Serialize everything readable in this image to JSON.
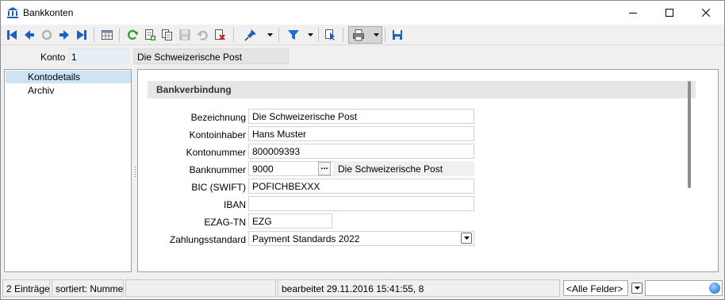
{
  "window": {
    "title": "Bankkonten"
  },
  "toolbar": {
    "buttons": [
      "first-record-icon",
      "previous-record-icon",
      "disabled-refresh-icon",
      "next-record-icon",
      "last-record-icon",
      "table-view-icon",
      "refresh-icon",
      "new-record-icon",
      "copy-record-icon",
      "save-icon",
      "undo-icon",
      "delete-icon",
      "pin-icon",
      "filter-icon",
      "cursor-icon",
      "print-icon",
      "save-disk-icon"
    ]
  },
  "header": {
    "konto_label": "Konto",
    "konto_value": "1",
    "konto_name": "Die Schweizerische Post"
  },
  "nav": {
    "items": [
      {
        "label": "Kontodetails",
        "selected": true
      },
      {
        "label": "Archiv",
        "selected": false
      }
    ]
  },
  "section": {
    "title": "Bankverbindung"
  },
  "form": {
    "bezeichnung_label": "Bezeichnung",
    "bezeichnung_value": "Die Schweizerische Post",
    "kontoinhaber_label": "Kontoinhaber",
    "kontoinhaber_value": "Hans Muster",
    "kontonummer_label": "Kontonummer",
    "kontonummer_value": "800009393",
    "banknummer_label": "Banknummer",
    "banknummer_value": "9000",
    "banknummer_button": "...",
    "bank_name": "Die Schweizerische Post",
    "bic_label": "BIC (SWIFT)",
    "bic_value": "POFICHBEXXX",
    "iban_label": "IBAN",
    "iban_value": "",
    "ezag_label": "EZAG-TN",
    "ezag_value": "EZG",
    "zahlungsstandard_label": "Zahlungsstandard",
    "zahlungsstandard_value": "Payment Standards 2022"
  },
  "status": {
    "entries": "2 Einträge",
    "sorted": "sortiert: Nummer",
    "empty": "",
    "edited": "bearbeitet 29.11.2016 15:41:55,  8",
    "field_select": "<Alle Felder>",
    "search_value": ""
  },
  "colors": {
    "accent_blue": "#1f5fbf",
    "selection": "#cde4f7",
    "section_bg": "#e6e6e6"
  }
}
